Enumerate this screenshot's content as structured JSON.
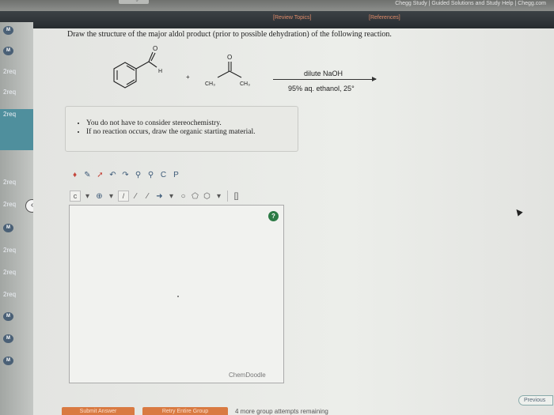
{
  "browser": {
    "title": "Chegg Study | Guided Solutions and Study Help | Chegg.com",
    "cut_tab": "ning"
  },
  "header": {
    "review_topics": "[Review Topics]",
    "references": "[References]"
  },
  "sidebar": {
    "items": [
      {
        "label": "M",
        "type": "badge"
      },
      {
        "label": "M",
        "type": "badge"
      },
      {
        "label": "2req",
        "type": "text"
      },
      {
        "label": "2req",
        "type": "text"
      },
      {
        "label": "2req",
        "type": "text",
        "active": true
      },
      {
        "label": "2req",
        "type": "text"
      },
      {
        "label": "2req",
        "type": "text"
      },
      {
        "label": "M",
        "type": "badge"
      },
      {
        "label": "2req",
        "type": "text"
      },
      {
        "label": "2req",
        "type": "text"
      },
      {
        "label": "2req",
        "type": "text"
      },
      {
        "label": "M",
        "type": "badge"
      },
      {
        "label": "M",
        "type": "badge"
      },
      {
        "label": "M",
        "type": "badge"
      }
    ],
    "collapse_icon": "chevron-left-icon"
  },
  "question": {
    "prompt": "Draw the structure of the major aldol product (prior to possible dehydration) of the following reaction.",
    "reactant1_labels": {
      "oxygen": "O",
      "hydrogen": "H"
    },
    "plus": "+",
    "reactant2_labels": {
      "oxygen": "O",
      "ch3_left": "CH₃",
      "ch3_right": "CH₃"
    },
    "reagent_top": "dilute NaOH",
    "reagent_bottom": "95% aq. ethanol, 25°"
  },
  "instructions": [
    "You do not have to consider stereochemistry.",
    "If no reaction occurs, draw the organic starting material."
  ],
  "toolbar": {
    "row1": [
      "eraser-icon",
      "pencil-icon",
      "lasso-icon",
      "undo-icon",
      "redo-icon",
      "zoom-in-icon",
      "zoom-out-icon",
      "copy-icon",
      "paste-icon"
    ],
    "row2": [
      "charge-icon",
      "dropdown-icon",
      "radical-icon",
      "dropdown-icon",
      "single-bond-icon",
      "double-bond-icon",
      "triple-bond-icon",
      "wedge-bond-icon",
      "dropdown-icon",
      "cyclopropane-icon",
      "cyclopentane-icon",
      "hexagon-icon",
      "dropdown-icon",
      "bracket-icon"
    ],
    "copy_label": "C",
    "paste_label": "P"
  },
  "canvas": {
    "label": "ChemDoodle",
    "help": "?"
  },
  "footer": {
    "submit_label": "Submit Answer",
    "retry_label": "Retry Entire Group",
    "attempts": "4 more group attempts remaining",
    "previous_label": "Previous"
  },
  "colors": {
    "header": "#2c3134",
    "accent_orange": "#d97a42",
    "sidebar_badge": "#4a6076",
    "active_item": "#4f8f9d",
    "help_green": "#2c7a45"
  }
}
